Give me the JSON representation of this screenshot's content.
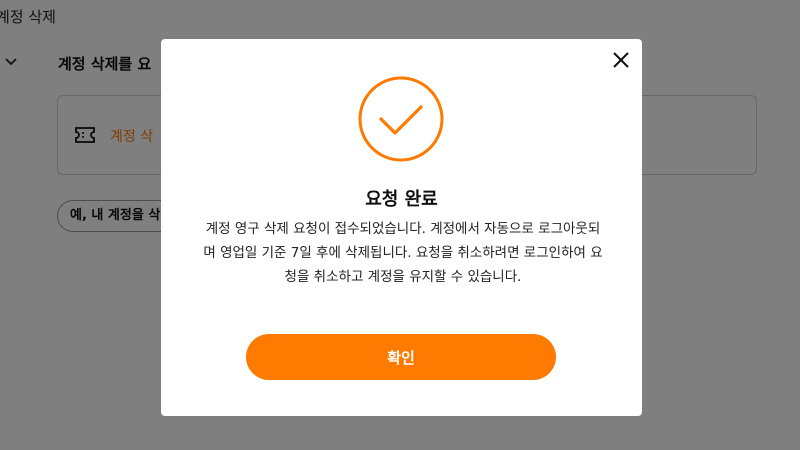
{
  "background": {
    "page_title": "계정 삭제",
    "question": "계정 삭제를 요",
    "card_text": "계정 삭",
    "chip_text": "예, 내 계정을 삭"
  },
  "modal": {
    "title": "요청 완료",
    "message": "계정 영구 삭제 요청이 접수되었습니다. 계정에서 자동으로 로그아웃되며 영업일 기준 7일 후에 삭제됩니다. 요청을 취소하려면 로그인하여 요청을 취소하고 계정을 유지할 수 있습니다.",
    "confirm_label": "확인",
    "icons": {
      "close": "close-icon",
      "status": "check-circle-icon"
    }
  },
  "colors": {
    "accent": "#ff7a00",
    "overlay": "rgba(0,0,0,0.5)",
    "text": "#222222"
  }
}
